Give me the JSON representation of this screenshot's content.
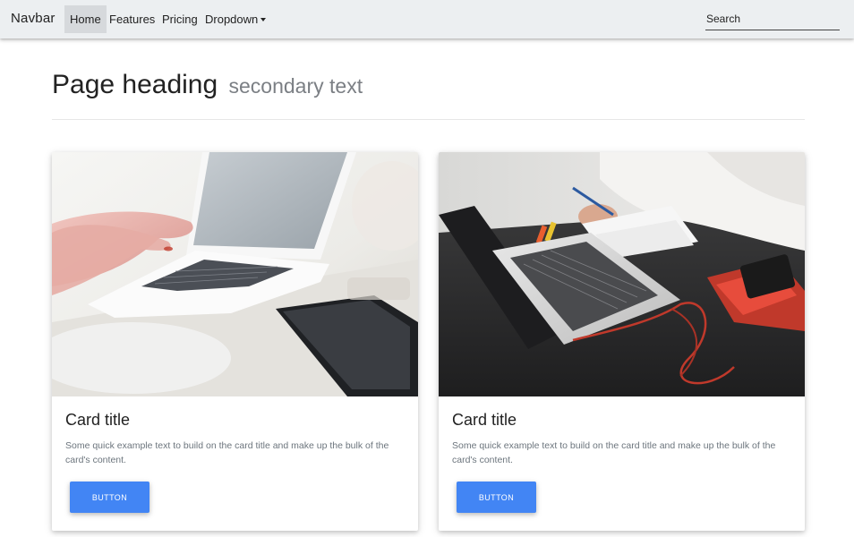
{
  "navbar": {
    "brand": "Navbar",
    "items": [
      {
        "label": "Home",
        "active": true
      },
      {
        "label": "Features"
      },
      {
        "label": "Pricing"
      },
      {
        "label": "Dropdown"
      }
    ],
    "search_placeholder": "Search"
  },
  "heading": {
    "title": "Page heading",
    "secondary": "secondary text"
  },
  "cards": [
    {
      "image_icon": "laptop-hands-photo",
      "title": "Card title",
      "text": "Some quick example text to build on the card title and make up the bulk of the card's content.",
      "button": "BUTTON"
    },
    {
      "image_icon": "laptop-desk-photo",
      "title": "Card title",
      "text": "Some quick example text to build on the card title and make up the bulk of the card's content.",
      "button": "BUTTON"
    }
  ],
  "colors": {
    "navbar_bg": "#eceff1",
    "button_primary": "#4285f4",
    "secondary_text": "#7b7f84"
  }
}
